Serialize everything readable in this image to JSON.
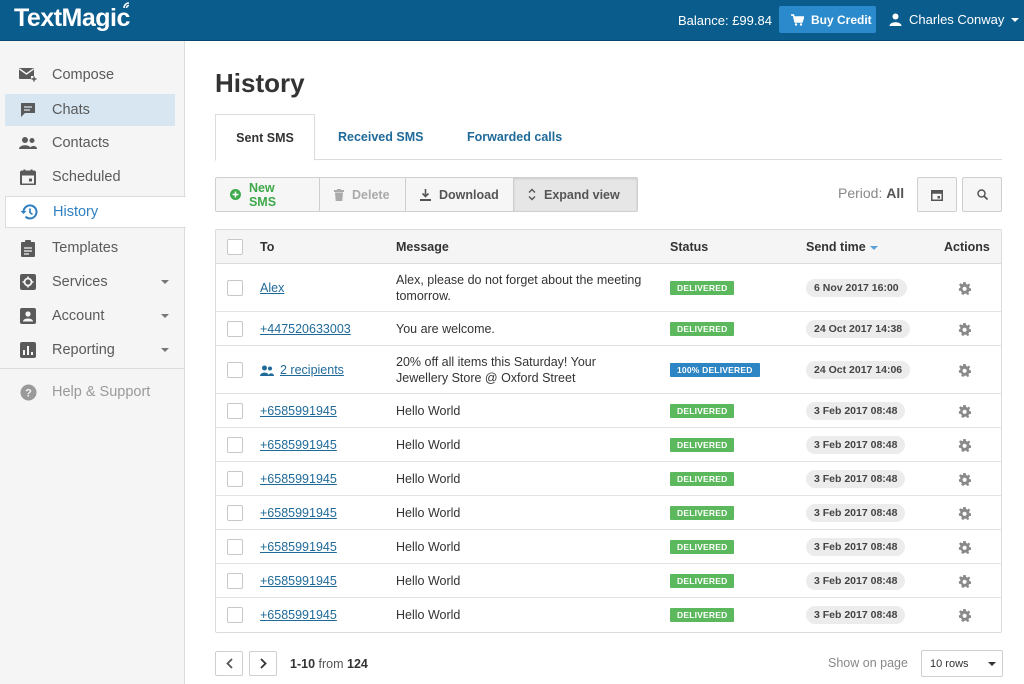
{
  "header": {
    "logo": "TextMagic",
    "balance": "Balance: £99.84",
    "buy_credit": "Buy Credit",
    "user_name": "Charles Conway"
  },
  "sidebar": {
    "items": [
      {
        "label": "Compose",
        "icon": "compose-icon"
      },
      {
        "label": "Chats",
        "icon": "chat-icon"
      },
      {
        "label": "Contacts",
        "icon": "contacts-icon"
      },
      {
        "label": "Scheduled",
        "icon": "calendar-icon"
      },
      {
        "label": "History",
        "icon": "history-icon"
      },
      {
        "label": "Templates",
        "icon": "clipboard-icon"
      },
      {
        "label": "Services",
        "icon": "services-icon"
      },
      {
        "label": "Account",
        "icon": "account-icon"
      },
      {
        "label": "Reporting",
        "icon": "chart-icon"
      },
      {
        "label": "Help & Support",
        "icon": "help-icon"
      }
    ]
  },
  "main": {
    "title": "History",
    "tabs": [
      "Sent SMS",
      "Received SMS",
      "Forwarded calls"
    ],
    "toolbar": {
      "new_sms": "New SMS",
      "delete": "Delete",
      "download": "Download",
      "expand_view": "Expand view"
    },
    "period_label": "Period:",
    "period_value": "All"
  },
  "table": {
    "columns": {
      "to": "To",
      "message": "Message",
      "status": "Status",
      "send_time": "Send time",
      "actions": "Actions"
    },
    "rows": [
      {
        "to": "Alex",
        "message": "Alex, please do not forget about the meeting tomorrow.",
        "status": "DELIVERED",
        "time": "6 Nov 2017 16:00"
      },
      {
        "to": "+447520633003",
        "message": "You are welcome.",
        "status": "DELIVERED",
        "time": "24 Oct 2017 14:38"
      },
      {
        "to": "2 recipients",
        "message": "20% off all items this Saturday! Your Jewellery Store @ Oxford Street",
        "status": "100% DELIVERED",
        "time": "24 Oct 2017 14:06"
      },
      {
        "to": "+6585991945",
        "message": "Hello World",
        "status": "DELIVERED",
        "time": "3 Feb 2017 08:48"
      },
      {
        "to": "+6585991945",
        "message": "Hello World",
        "status": "DELIVERED",
        "time": "3 Feb 2017 08:48"
      },
      {
        "to": "+6585991945",
        "message": "Hello World",
        "status": "DELIVERED",
        "time": "3 Feb 2017 08:48"
      },
      {
        "to": "+6585991945",
        "message": "Hello World",
        "status": "DELIVERED",
        "time": "3 Feb 2017 08:48"
      },
      {
        "to": "+6585991945",
        "message": "Hello World",
        "status": "DELIVERED",
        "time": "3 Feb 2017 08:48"
      },
      {
        "to": "+6585991945",
        "message": "Hello World",
        "status": "DELIVERED",
        "time": "3 Feb 2017 08:48"
      },
      {
        "to": "+6585991945",
        "message": "Hello World",
        "status": "DELIVERED",
        "time": "3 Feb 2017 08:48"
      }
    ]
  },
  "pagination": {
    "range": "1-10",
    "from_word": "from",
    "total": "124",
    "show_on_page": "Show on page",
    "rows_option": "10 rows"
  },
  "colors": {
    "header_bg": "#0a5c8d",
    "accent": "#2f7fc1",
    "delivered": "#5cb85c",
    "delivered_pct": "#2e85c3"
  }
}
